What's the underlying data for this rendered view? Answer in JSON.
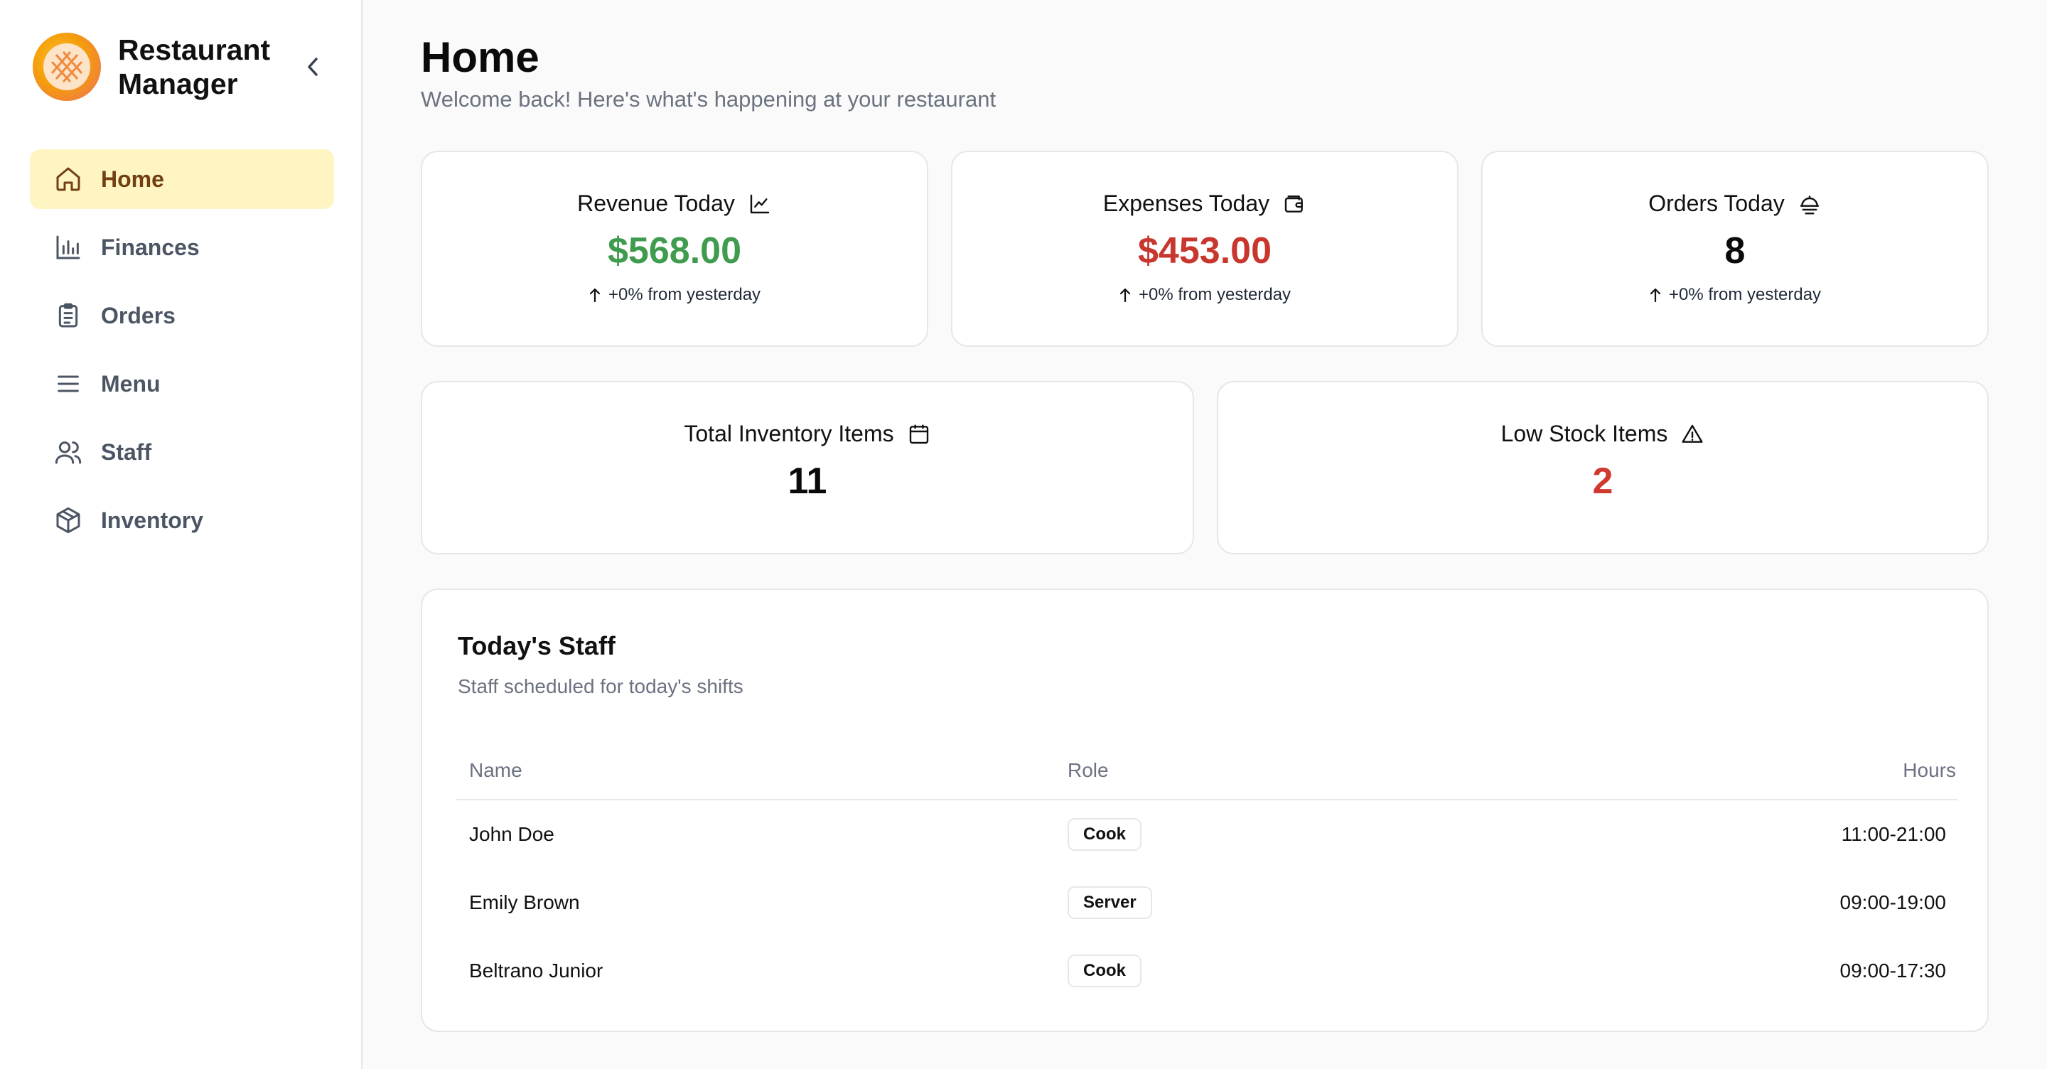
{
  "brand": {
    "line1": "Restaurant",
    "line2": "Manager"
  },
  "sidebar": {
    "items": [
      {
        "label": "Home",
        "icon": "home-icon",
        "active": true
      },
      {
        "label": "Finances",
        "icon": "bar-chart-icon"
      },
      {
        "label": "Orders",
        "icon": "clipboard-list-icon"
      },
      {
        "label": "Menu",
        "icon": "menu-lines-icon"
      },
      {
        "label": "Staff",
        "icon": "users-icon"
      },
      {
        "label": "Inventory",
        "icon": "package-icon"
      }
    ]
  },
  "header": {
    "title": "Home",
    "subtitle": "Welcome back! Here's what's happening at your restaurant"
  },
  "stats": {
    "revenue": {
      "label": "Revenue Today",
      "value": "$568.00",
      "change": "+0% from yesterday",
      "icon": "trend-chart-icon"
    },
    "expenses": {
      "label": "Expenses Today",
      "value": "$453.00",
      "change": "+0% from yesterday",
      "icon": "wallet-icon"
    },
    "orders": {
      "label": "Orders Today",
      "value": "8",
      "change": "+0% from yesterday",
      "icon": "cloche-icon"
    },
    "inventory": {
      "label": "Total Inventory Items",
      "value": "11",
      "icon": "calendar-box-icon"
    },
    "low_stock": {
      "label": "Low Stock Items",
      "value": "2",
      "icon": "warning-triangle-icon"
    }
  },
  "staff": {
    "title": "Today's Staff",
    "subtitle": "Staff scheduled for today's shifts",
    "columns": {
      "name": "Name",
      "role": "Role",
      "hours": "Hours"
    },
    "rows": [
      {
        "name": "John Doe",
        "role": "Cook",
        "hours": "11:00-21:00"
      },
      {
        "name": "Emily Brown",
        "role": "Server",
        "hours": "09:00-19:00"
      },
      {
        "name": "Beltrano Junior",
        "role": "Cook",
        "hours": "09:00-17:30"
      }
    ]
  },
  "colors": {
    "accent_active_bg": "#fef5c3",
    "revenue_green": "#3f9b4d",
    "expense_red": "#c8372d",
    "low_stock_red": "#d0392f"
  }
}
